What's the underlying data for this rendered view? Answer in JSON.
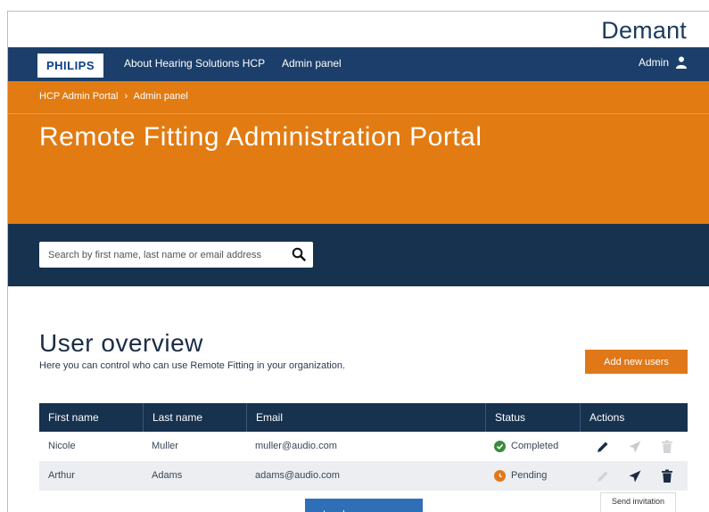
{
  "header": {
    "brand_logo": "Demant",
    "partner_logo": "PHILIPS"
  },
  "nav": {
    "about_label": "About Hearing Solutions HCP",
    "admin_panel_label": "Admin panel",
    "user_label": "Admin",
    "user_icon": "person-icon"
  },
  "breadcrumb": {
    "items": [
      "HCP Admin Portal",
      "Admin panel"
    ],
    "separator": "›"
  },
  "hero": {
    "title": "Remote Fitting Administration Portal"
  },
  "search": {
    "placeholder": "Search by first name, last name or email address",
    "value": "",
    "icon": "search-icon"
  },
  "overview": {
    "title": "User overview",
    "subtitle": "Here you can control who can use Remote Fitting in your organization.",
    "add_button": "Add new users"
  },
  "table": {
    "columns": [
      "First name",
      "Last name",
      "Email",
      "Status",
      "Actions"
    ],
    "rows": [
      {
        "first": "Nicole",
        "last": "Muller",
        "email": "muller@audio.com",
        "status": "Completed"
      },
      {
        "first": "Arthur",
        "last": "Adams",
        "email": "adams@audio.com",
        "status": "Pending"
      }
    ]
  },
  "tooltip": {
    "text": "Send invitation"
  },
  "load_more": "Load more users...",
  "colors": {
    "nav": "#1b3f6a",
    "hero": "#e27b12",
    "search_band": "#17324f",
    "accent": "#e0781a",
    "completed": "#3b8b3b",
    "pending": "#e0781a",
    "load_button": "#2f6fb7"
  }
}
